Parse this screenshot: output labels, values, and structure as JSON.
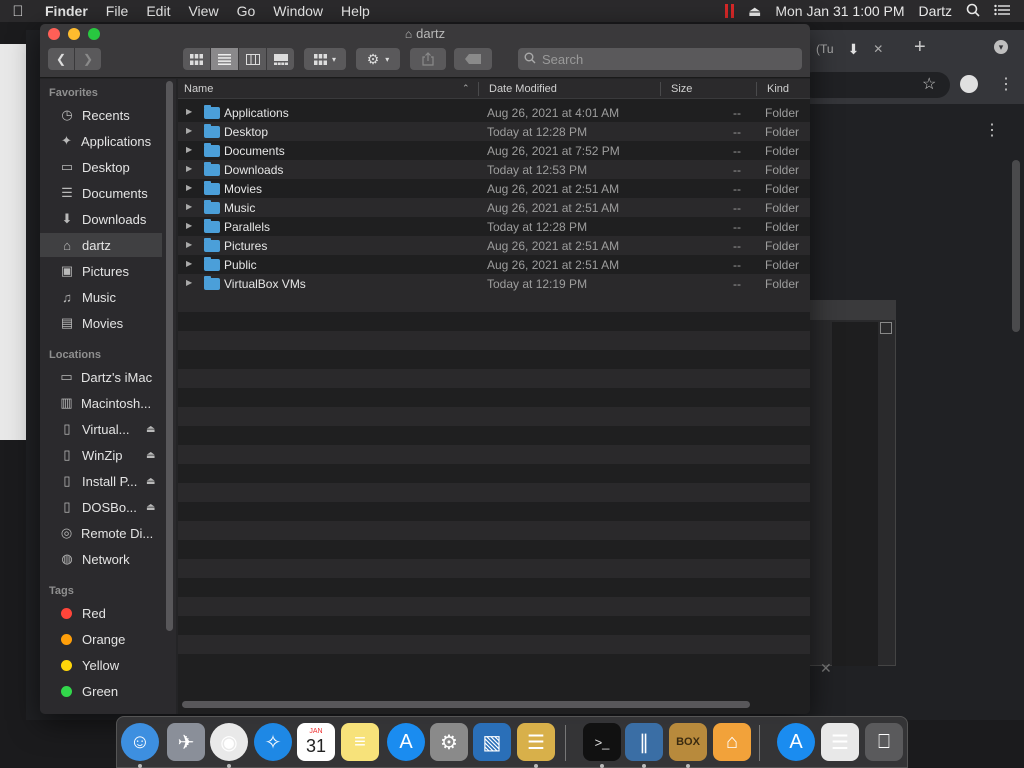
{
  "menubar": {
    "apple": "",
    "app": "Finder",
    "menus": [
      "File",
      "Edit",
      "View",
      "Go",
      "Window",
      "Help"
    ],
    "clock": "Mon Jan 31  1:00 PM",
    "user": "Dartz"
  },
  "chrome": {
    "tab_text": "(Tu",
    "newtab": "+",
    "close": "✕"
  },
  "window": {
    "title": "dartz",
    "search_placeholder": "Search"
  },
  "sidebar": {
    "favorites_header": "Favorites",
    "favorites": [
      {
        "label": "Recents",
        "icon": "clock-icon",
        "glyph": "◷"
      },
      {
        "label": "Applications",
        "icon": "applications-icon",
        "glyph": "✦"
      },
      {
        "label": "Desktop",
        "icon": "desktop-icon",
        "glyph": "▭"
      },
      {
        "label": "Documents",
        "icon": "document-icon",
        "glyph": "☰"
      },
      {
        "label": "Downloads",
        "icon": "download-icon",
        "glyph": "⬇"
      },
      {
        "label": "dartz",
        "icon": "home-icon",
        "glyph": "⌂"
      },
      {
        "label": "Pictures",
        "icon": "camera-icon",
        "glyph": "▣"
      },
      {
        "label": "Music",
        "icon": "music-note-icon",
        "glyph": "♫"
      },
      {
        "label": "Movies",
        "icon": "film-icon",
        "glyph": "▤"
      }
    ],
    "locations_header": "Locations",
    "locations": [
      {
        "label": "Dartz's iMac",
        "icon": "imac-icon",
        "glyph": "▭",
        "eject": ""
      },
      {
        "label": "Macintosh...",
        "icon": "hard-disk-icon",
        "glyph": "▥",
        "eject": ""
      },
      {
        "label": "Virtual...",
        "icon": "disk-image-icon",
        "glyph": "▯",
        "eject": "⏏"
      },
      {
        "label": "WinZip",
        "icon": "disk-image-icon",
        "glyph": "▯",
        "eject": "⏏"
      },
      {
        "label": "Install P...",
        "icon": "disk-image-icon",
        "glyph": "▯",
        "eject": "⏏"
      },
      {
        "label": "DOSBo...",
        "icon": "disk-image-icon",
        "glyph": "▯",
        "eject": "⏏"
      },
      {
        "label": "Remote Di...",
        "icon": "optical-disc-icon",
        "glyph": "◎",
        "eject": ""
      },
      {
        "label": "Network",
        "icon": "globe-icon",
        "glyph": "◍",
        "eject": ""
      }
    ],
    "tags_header": "Tags",
    "tags": [
      {
        "label": "Red",
        "color": "#ff453a"
      },
      {
        "label": "Orange",
        "color": "#ff9f0a"
      },
      {
        "label": "Yellow",
        "color": "#ffd60a"
      },
      {
        "label": "Green",
        "color": "#32d74b"
      }
    ]
  },
  "list": {
    "headers": {
      "name": "Name",
      "date": "Date Modified",
      "size": "Size",
      "kind": "Kind"
    },
    "rows": [
      {
        "name": "Applications",
        "date": "Aug 26, 2021 at 4:01 AM",
        "size": "--",
        "kind": "Folder"
      },
      {
        "name": "Desktop",
        "date": "Today at 12:28 PM",
        "size": "--",
        "kind": "Folder"
      },
      {
        "name": "Documents",
        "date": "Aug 26, 2021 at 7:52 PM",
        "size": "--",
        "kind": "Folder"
      },
      {
        "name": "Downloads",
        "date": "Today at 12:53 PM",
        "size": "--",
        "kind": "Folder"
      },
      {
        "name": "Movies",
        "date": "Aug 26, 2021 at 2:51 AM",
        "size": "--",
        "kind": "Folder"
      },
      {
        "name": "Music",
        "date": "Aug 26, 2021 at 2:51 AM",
        "size": "--",
        "kind": "Folder"
      },
      {
        "name": "Parallels",
        "date": "Today at 12:28 PM",
        "size": "--",
        "kind": "Folder"
      },
      {
        "name": "Pictures",
        "date": "Aug 26, 2021 at 2:51 AM",
        "size": "--",
        "kind": "Folder"
      },
      {
        "name": "Public",
        "date": "Aug 26, 2021 at 2:51 AM",
        "size": "--",
        "kind": "Folder"
      },
      {
        "name": "VirtualBox VMs",
        "date": "Today at 12:19 PM",
        "size": "--",
        "kind": "Folder"
      }
    ]
  },
  "dock": {
    "calendar_month": "JAN",
    "calendar_day": "31",
    "dosbox_text": "BOX",
    "items": [
      {
        "name": "finder",
        "icon": "finder-icon",
        "color": "#3d8fe0",
        "glyph": "☺",
        "running": true
      },
      {
        "name": "launchpad",
        "icon": "rocket-icon",
        "color": "#8a8f99",
        "glyph": "✈",
        "running": false
      },
      {
        "name": "chrome",
        "icon": "chrome-icon",
        "color": "#e9e9e9",
        "glyph": "◉",
        "running": true
      },
      {
        "name": "safari",
        "icon": "compass-icon",
        "color": "#1e88e5",
        "glyph": "✧",
        "running": false
      },
      {
        "name": "calendar",
        "icon": "calendar-icon",
        "color": "#ffffff",
        "glyph": "",
        "running": false
      },
      {
        "name": "notes",
        "icon": "notes-icon",
        "color": "#f7e27a",
        "glyph": "≡",
        "running": false
      },
      {
        "name": "app-store",
        "icon": "app-store-icon",
        "color": "#1a8cf0",
        "glyph": "A",
        "running": false
      },
      {
        "name": "system-preferences",
        "icon": "gear-icon",
        "color": "#8a8a8a",
        "glyph": "⚙",
        "running": false
      },
      {
        "name": "virtualbox",
        "icon": "virtualbox-icon",
        "color": "#2a6fb8",
        "glyph": "▧",
        "running": false
      },
      {
        "name": "archive-utility",
        "icon": "zip-icon",
        "color": "#d8b04a",
        "glyph": "☰",
        "running": true
      },
      {
        "name": "terminal",
        "icon": "terminal-icon",
        "color": "#111111",
        "glyph": ">_",
        "running": true
      },
      {
        "name": "parallels",
        "icon": "parallels-icon",
        "color": "#3a6ea5",
        "glyph": "∥",
        "running": true
      },
      {
        "name": "dosbox",
        "icon": "dosbox-icon",
        "color": "#b88a3c",
        "glyph": "",
        "running": true
      },
      {
        "name": "home",
        "icon": "home-icon",
        "color": "#f2a23a",
        "glyph": "⌂",
        "running": false
      },
      {
        "name": "app-store-folder",
        "icon": "app-store-icon",
        "color": "#1a8cf0",
        "glyph": "A",
        "running": false
      },
      {
        "name": "document",
        "icon": "document-icon",
        "color": "#e8e8e8",
        "glyph": "☰",
        "running": false
      },
      {
        "name": "trash",
        "icon": "trash-icon",
        "color": "#5a5a5c",
        "glyph": "⎕",
        "running": false
      }
    ]
  }
}
